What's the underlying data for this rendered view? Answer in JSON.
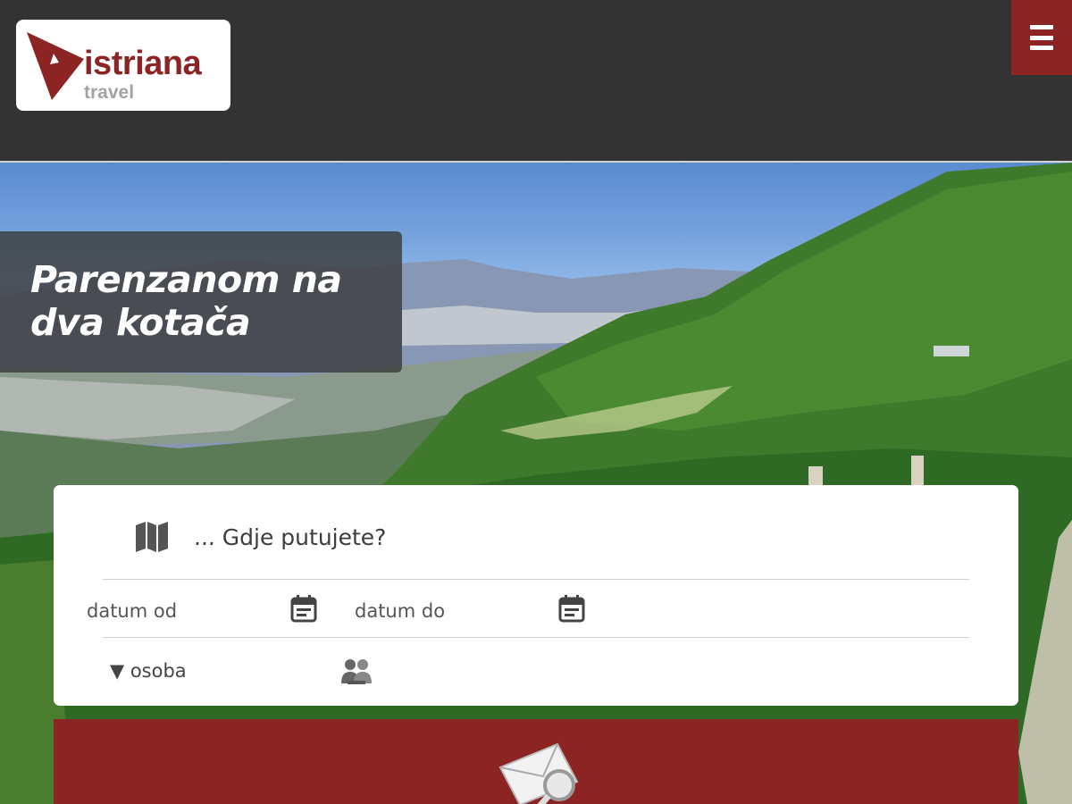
{
  "header": {
    "logo_name": "istriana",
    "logo_sub": "travel",
    "menu_icon": "hamburger-menu-icon",
    "background": "#333333",
    "accent": "#8d2424"
  },
  "hero": {
    "title": "Parenzanom na dva kotača"
  },
  "search": {
    "destination_placeholder": "... Gdje putujete?",
    "destination_icon": "map-icon",
    "date_from_placeholder": "datum od",
    "date_to_placeholder": "datum do",
    "calendar_icon": "calendar-icon",
    "persons_label": "▼ osoba",
    "persons_icon": "people-icon",
    "submit_icon": "envelope-search-icon"
  }
}
